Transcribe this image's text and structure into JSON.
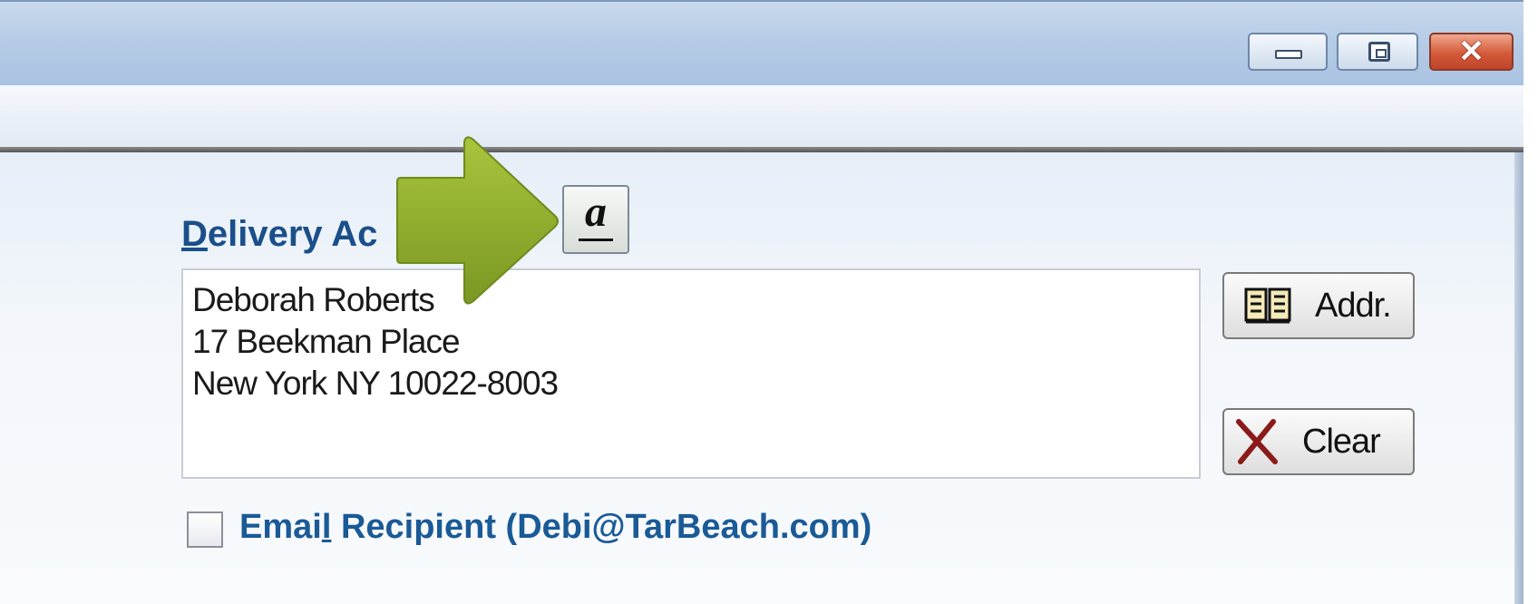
{
  "window": {
    "controls": {
      "minimize_icon": "minimize-icon",
      "maximize_icon": "maximize-icon",
      "close_glyph": "✕"
    }
  },
  "delivery": {
    "label_accel": "D",
    "label_rest": "elivery Ac",
    "address_lines": [
      "Deborah Roberts",
      "17 Beekman Place",
      "New York NY 10022-8003"
    ],
    "format_button_glyph": "a",
    "addr_button_label": "Addr.",
    "clear_button_label": "Clear"
  },
  "email": {
    "checked": false,
    "label_before": "Emai",
    "label_accel": "l",
    "label_after": " Recipient (Debi@TarBeach.com)"
  },
  "colors": {
    "label_blue": "#1a4f8a",
    "arrow_green": "#8fae2c",
    "close_red": "#d45a3a"
  }
}
